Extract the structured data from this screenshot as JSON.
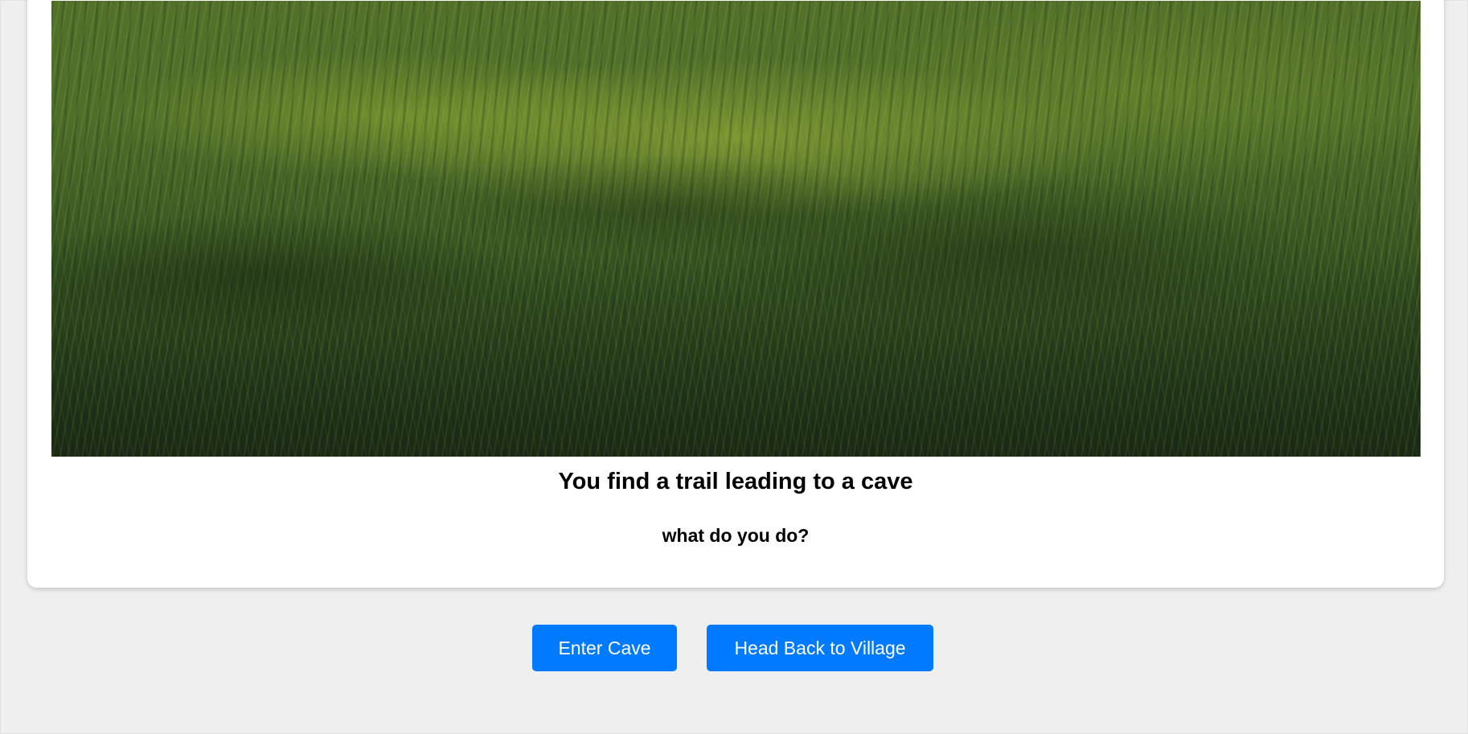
{
  "scene": {
    "image_alt": "grass field at sunset",
    "title": "You find a trail leading to a cave",
    "prompt": "what do you do?"
  },
  "choices": [
    {
      "label": "Enter Cave"
    },
    {
      "label": "Head Back to Village"
    }
  ],
  "colors": {
    "page_background": "#efefef",
    "card_background": "#ffffff",
    "button": "#007bff",
    "button_text": "#ffffff"
  }
}
